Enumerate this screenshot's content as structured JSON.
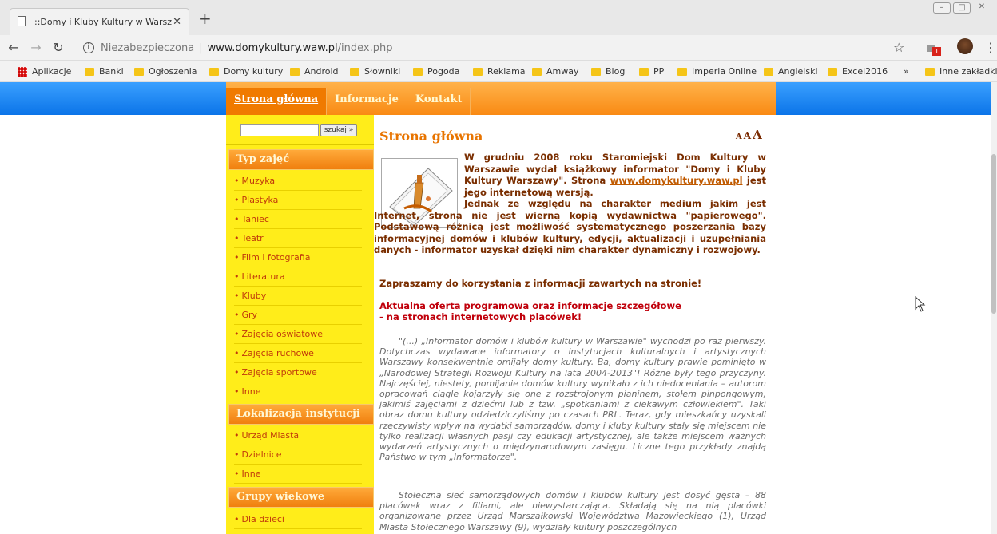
{
  "tab": {
    "title": "::Domy i Kluby Kultury w Warsz"
  },
  "address": {
    "insecure_label": "Niezabezpieczona",
    "url_host": "www.domykultury.waw.pl",
    "url_path": "/index.php"
  },
  "extension_badge": "1",
  "bookmarks": {
    "apps": "Aplikacje",
    "items": [
      "Banki",
      "Ogłoszenia",
      "Domy kultury",
      "Android",
      "Słowniki",
      "Pogoda",
      "Reklama",
      "Amway",
      "Blog",
      "PP",
      "Imperia Online",
      "Angielski",
      "Excel2016"
    ],
    "more": "»",
    "other": "Inne zakładki"
  },
  "nav": [
    "Strona główna",
    "Informacje",
    "Kontakt"
  ],
  "search": {
    "button": "szukaj »"
  },
  "sidebar": {
    "sections": [
      {
        "title": "Typ zajęć",
        "items": [
          "Muzyka",
          "Plastyka",
          "Taniec",
          "Teatr",
          "Film i fotografia",
          "Literatura",
          "Kluby",
          "Gry",
          "Zajęcia oświatowe",
          "Zajęcia ruchowe",
          "Zajęcia sportowe",
          "Inne"
        ]
      },
      {
        "title": "Lokalizacja instytucji",
        "items": [
          "Urząd Miasta",
          "Dzielnice",
          "Inne"
        ]
      },
      {
        "title": "Grupy wiekowe",
        "items": [
          "Dla dzieci"
        ]
      }
    ]
  },
  "content": {
    "title": "Strona główna",
    "font_sizes": [
      "A",
      "A",
      "A"
    ],
    "intro_before_link": "W grudniu 2008 roku Staromiejski Dom Kultury w Warszawie wydał książkowy informator \"Domy i Kluby Kultury Warszawy\". Strona",
    "link": "www.domykultury.waw.pl",
    "intro_after_link": "jest jego internetową wersją.",
    "para2": "Jednak ze względu na charakter medium jakim jest Internet, strona nie jest wierną kopią wydawnictwa \"papierowego\". Podstawową różnicą jest możliwość systematycznego poszerzania bazy informacyjnej domów i klubów kultury, edycji, aktualizacji i uzupełniania danych - informator uzyskał dzięki nim charakter dynamiczny i rozwojowy.",
    "para3": "Zapraszamy do korzystania z informacji zawartych na stronie!",
    "red1": "Aktualna oferta programowa oraz informacje szczegółowe",
    "red2": "- na stronach internetowych placówek!",
    "quote1": "\"(...) „Informator domów i klubów kultury w Warszawie\" wychodzi po raz pierwszy. Dotychczas wydawane informatory o instytucjach kulturalnych i artystycznych Warszawy konsekwentnie omijały domy kultury. Ba, domy kultury prawie pominięto w „Narodowej Strategii Rozwoju Kultury na lata 2004-2013\"! Różne były tego przyczyny. Najczęściej, niestety, pomijanie domów kultury wynikało z ich niedoceniania – autorom opracowań ciągle kojarzyły się one z rozstrojonym pianinem, stołem pinpongowym, jakimiś zajęciami z dziećmi lub z tzw. „spotkaniami z ciekawym człowiekiem\". Taki obraz domu kultury odziedziczyliśmy po czasach PRL. Teraz, gdy mieszkańcy uzyskali rzeczywisty wpływ na wydatki samorządów, domy i kluby kultury stały się miejscem nie tylko realizacji własnych pasji czy edukacji artystycznej, ale także miejscem ważnych wydarzeń artystycznych o międzynarodowym zasięgu. Liczne tego przykłady znajdą Państwo w tym „Informatorze\".",
    "quote2": "Stołeczna sieć samorządowych domów i klubów kultury jest dosyć gęsta – 88 placówek wraz z filiami, ale niewystarczająca. Składają się na nią placówki organizowane przez Urząd Marszałkowski Województwa Mazowieckiego (1), Urząd Miasta Stołecznego Warszawy (9), wydziały kultury poszczególnych"
  },
  "colors": {
    "blue_bar": "#0b74e8",
    "orange": "#f98a13",
    "yellow": "#ffed1a",
    "title_orange": "#e87400",
    "link_red": "#c0390b"
  }
}
